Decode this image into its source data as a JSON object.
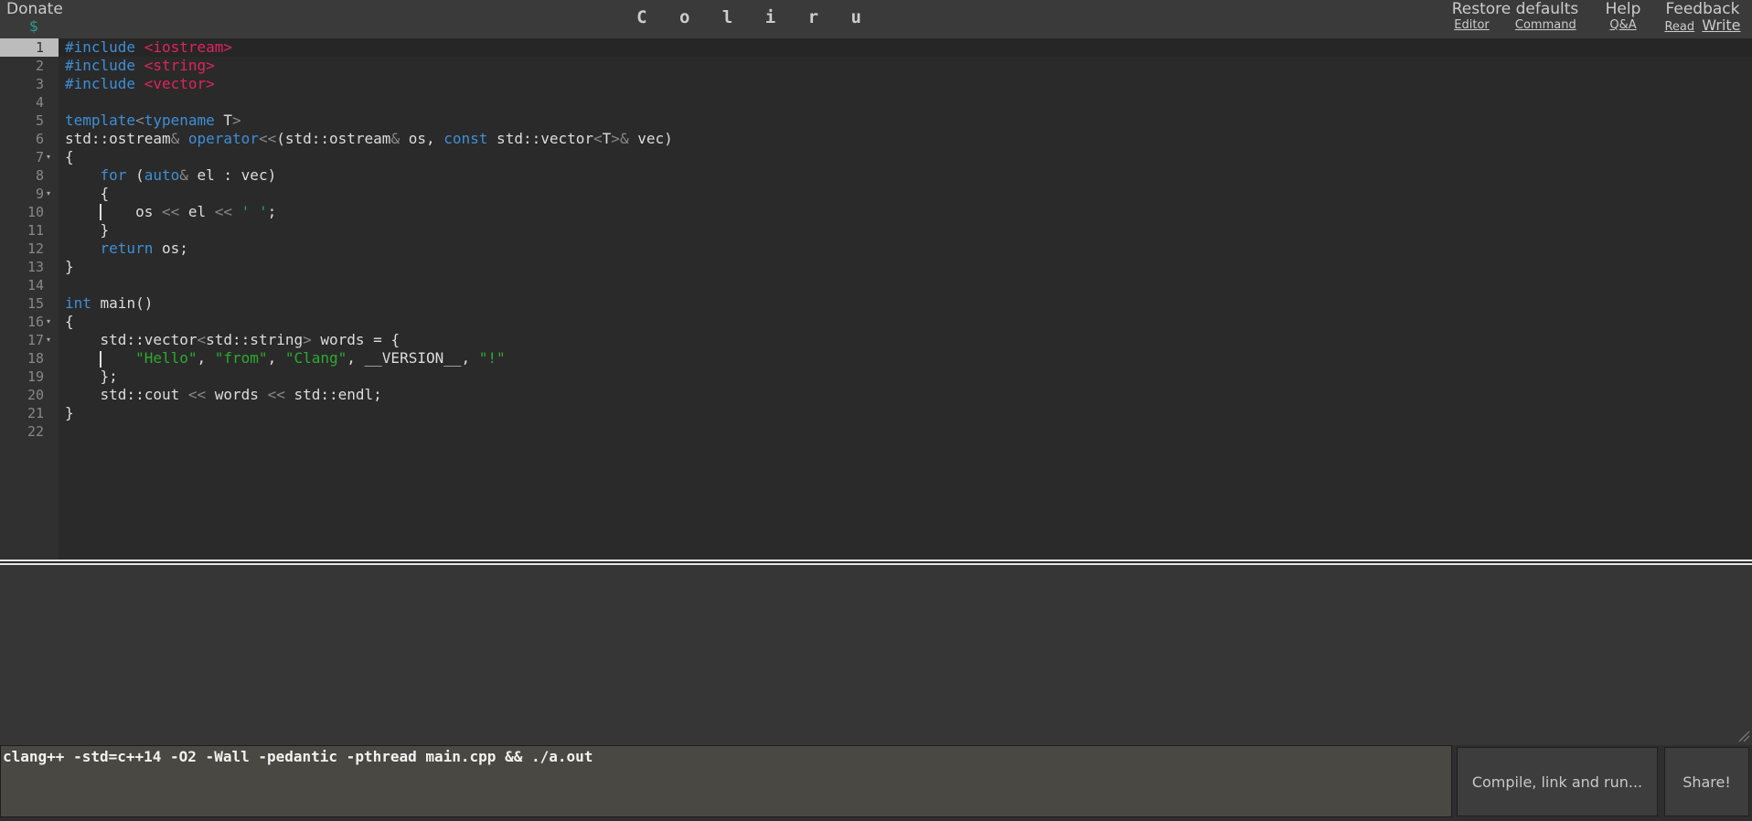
{
  "header": {
    "donate_label": "Donate",
    "donate_icon": "$",
    "title": "C o l i r u",
    "restore_defaults": {
      "label": "Restore defaults",
      "sub": [
        "Editor",
        "Command"
      ]
    },
    "help": {
      "label": "Help",
      "sub": [
        "Q&A"
      ]
    },
    "feedback": {
      "label": "Feedback",
      "sub": [
        "Read",
        "Write"
      ]
    }
  },
  "editor": {
    "line_numbers": [
      "1",
      "2",
      "3",
      "4",
      "5",
      "6",
      "7",
      "8",
      "9",
      "10",
      "11",
      "12",
      "13",
      "14",
      "15",
      "16",
      "17",
      "18",
      "19",
      "20",
      "21",
      "22"
    ],
    "active_line": 1,
    "lines": [
      [
        {
          "t": "#include ",
          "c": "kw"
        },
        {
          "t": "<iostream>",
          "c": "inc"
        }
      ],
      [
        {
          "t": "#include ",
          "c": "kw"
        },
        {
          "t": "<string>",
          "c": "inc"
        }
      ],
      [
        {
          "t": "#include ",
          "c": "kw"
        },
        {
          "t": "<vector>",
          "c": "inc"
        }
      ],
      [],
      [
        {
          "t": "template",
          "c": "kw"
        },
        {
          "t": "<",
          "c": "op"
        },
        {
          "t": "typename",
          "c": "kw"
        },
        {
          "t": " T"
        },
        {
          "t": ">",
          "c": "op"
        }
      ],
      [
        {
          "t": "std::ostream"
        },
        {
          "t": "&",
          "c": "op"
        },
        {
          "t": " "
        },
        {
          "t": "operator",
          "c": "kw"
        },
        {
          "t": "<<",
          "c": "op"
        },
        {
          "t": "(std::ostream"
        },
        {
          "t": "&",
          "c": "op"
        },
        {
          "t": " os, "
        },
        {
          "t": "const",
          "c": "kw"
        },
        {
          "t": " std::vector"
        },
        {
          "t": "<",
          "c": "op"
        },
        {
          "t": "T"
        },
        {
          "t": ">",
          "c": "op"
        },
        {
          "t": "&",
          "c": "op"
        },
        {
          "t": " vec)"
        }
      ],
      [
        {
          "t": "{"
        }
      ],
      [
        {
          "t": "    "
        },
        {
          "t": "for",
          "c": "kw"
        },
        {
          "t": " ("
        },
        {
          "t": "auto",
          "c": "kw"
        },
        {
          "t": "&",
          "c": "op"
        },
        {
          "t": " el : vec)"
        }
      ],
      [
        {
          "t": "    {"
        }
      ],
      [
        {
          "t": "        os "
        },
        {
          "t": "<<",
          "c": "op"
        },
        {
          "t": " el "
        },
        {
          "t": "<<",
          "c": "op"
        },
        {
          "t": " "
        },
        {
          "t": "' '",
          "c": "str"
        },
        {
          "t": ";"
        }
      ],
      [
        {
          "t": "    }"
        }
      ],
      [
        {
          "t": "    "
        },
        {
          "t": "return",
          "c": "kw"
        },
        {
          "t": " os;"
        }
      ],
      [
        {
          "t": "}"
        }
      ],
      [],
      [
        {
          "t": "int",
          "c": "kw"
        },
        {
          "t": " main()"
        }
      ],
      [
        {
          "t": "{"
        }
      ],
      [
        {
          "t": "    std::vector"
        },
        {
          "t": "<",
          "c": "op"
        },
        {
          "t": "std::string"
        },
        {
          "t": ">",
          "c": "op"
        },
        {
          "t": " words = {"
        }
      ],
      [
        {
          "t": "        "
        },
        {
          "t": "\"Hello\"",
          "c": "str"
        },
        {
          "t": ", "
        },
        {
          "t": "\"from\"",
          "c": "str"
        },
        {
          "t": ", "
        },
        {
          "t": "\"Clang\"",
          "c": "str"
        },
        {
          "t": ", __VERSION__, "
        },
        {
          "t": "\"!\"",
          "c": "str"
        }
      ],
      [
        {
          "t": "    };"
        }
      ],
      [
        {
          "t": "    std::cout "
        },
        {
          "t": "<<",
          "c": "op"
        },
        {
          "t": " words "
        },
        {
          "t": "<<",
          "c": "op"
        },
        {
          "t": " std::endl;"
        }
      ],
      [
        {
          "t": "}"
        }
      ],
      []
    ],
    "fold_markers": [
      "7",
      "9",
      "16",
      "17"
    ],
    "fold_icon": "▾"
  },
  "command": {
    "value": "clang++ -std=c++14 -O2 -Wall -pedantic -pthread main.cpp && ./a.out"
  },
  "buttons": {
    "compile": "Compile, link and run...",
    "share": "Share!"
  }
}
